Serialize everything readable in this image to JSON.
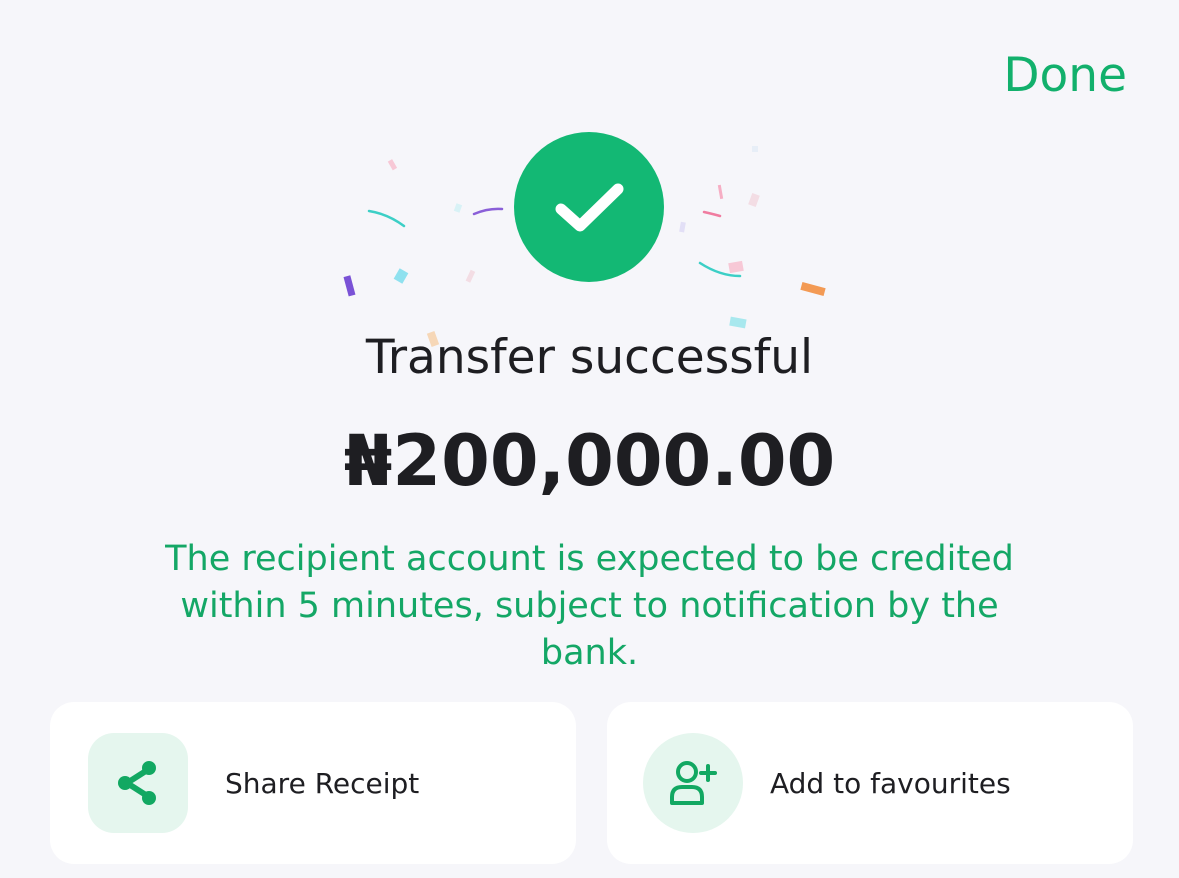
{
  "header": {
    "done_label": "Done"
  },
  "status": {
    "title": "Transfer successful",
    "amount": "₦200,000.00",
    "note": "The recipient account is expected to be credited within 5 minutes, subject to notification by the bank."
  },
  "actions": [
    {
      "label": "Share Receipt",
      "icon": "share-icon"
    },
    {
      "label": "Add to favourites",
      "icon": "add-user-icon"
    }
  ],
  "colors": {
    "accent": "#12b06c",
    "success_circle": "#13b874",
    "icon_bg": "#e5f6ee",
    "background": "#f6f6fa",
    "text": "#1e1e22"
  }
}
